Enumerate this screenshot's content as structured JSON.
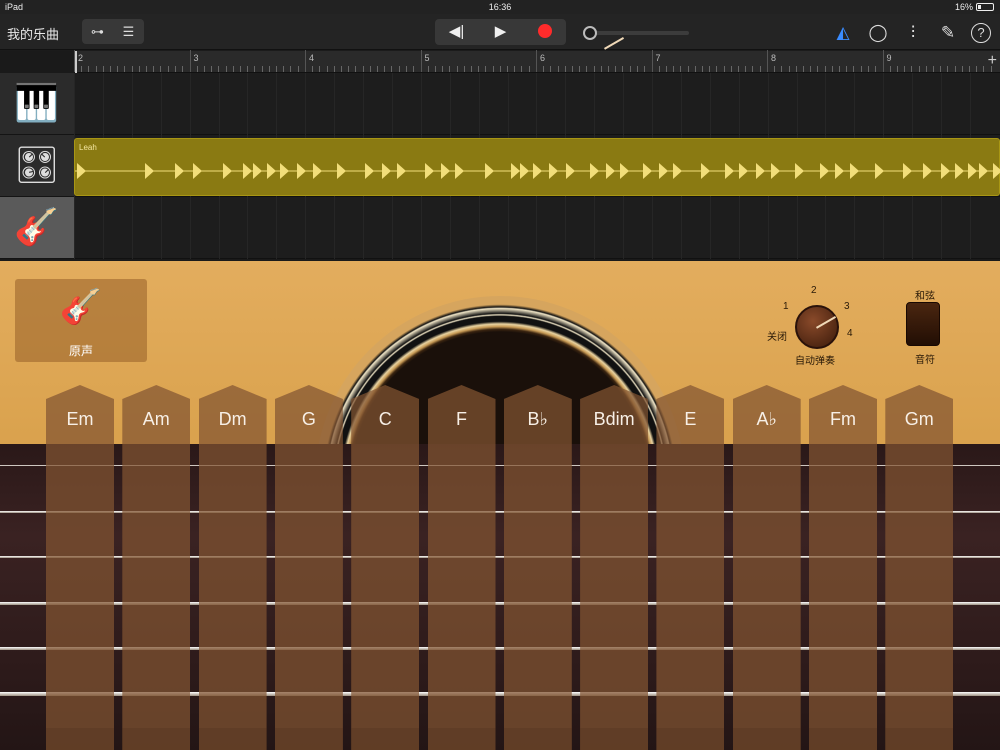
{
  "status": {
    "device": "iPad",
    "time": "16:36",
    "battery": "16%"
  },
  "toolbar": {
    "my_songs": "我的乐曲",
    "view_tracks_icon": "tracks-view-icon",
    "view_mixer_icon": "list-view-icon",
    "rewind_icon": "◀|",
    "play_icon": "▶",
    "metronome_icon": "metronome-icon",
    "loop_icon": "loop-icon",
    "mixer_icon": "mixer-icon",
    "settings_icon": "wrench-icon",
    "help_icon": "?",
    "accent": "#3a8cff"
  },
  "ruler": {
    "bars": [
      "2",
      "3",
      "4",
      "5",
      "6",
      "7",
      "8",
      "9"
    ],
    "add": "+"
  },
  "tracks": [
    {
      "instrument": "piano-icon",
      "glyph": "🎹"
    },
    {
      "instrument": "drum-machine-icon",
      "glyph": "🎛"
    },
    {
      "instrument": "acoustic-guitar-icon",
      "glyph": "🎸"
    }
  ],
  "region": {
    "name": "Leah",
    "color": "#8a7a12"
  },
  "instrument_button": {
    "glyph": "🎸",
    "label": "原声"
  },
  "autoplay": {
    "label": "自动弹奏",
    "off": "关闭",
    "n1": "1",
    "n2": "2",
    "n3": "3",
    "n4": "4"
  },
  "mode_toggle": {
    "top": "和弦",
    "bottom": "音符"
  },
  "chords": [
    "Em",
    "Am",
    "Dm",
    "G",
    "C",
    "F",
    "B♭",
    "Bdim",
    "E",
    "A♭",
    "Fm",
    "Gm"
  ]
}
